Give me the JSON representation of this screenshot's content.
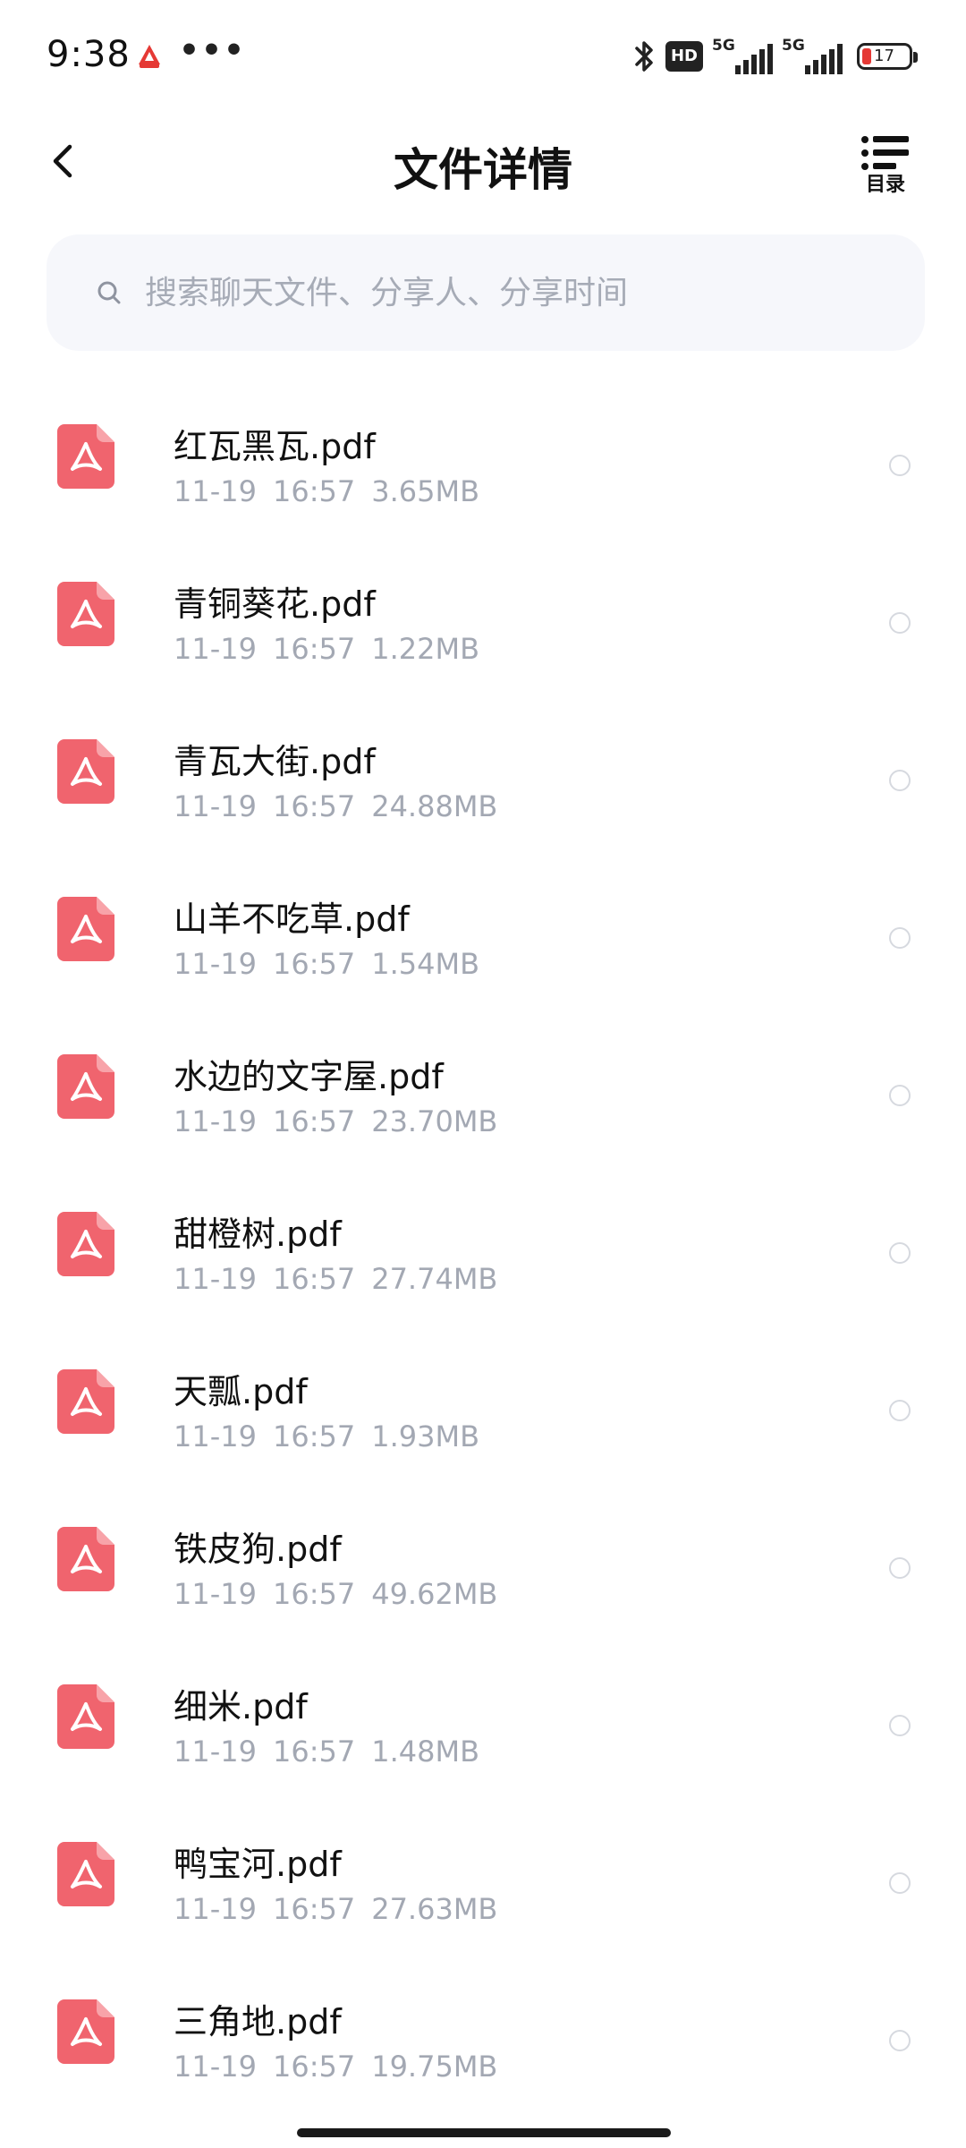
{
  "status_bar": {
    "time": "9:38",
    "dots": "•••",
    "hd_badge": "HD",
    "signal1_label": "5G",
    "signal2_label": "5G",
    "battery_level": "17"
  },
  "header": {
    "title": "文件详情",
    "catalog_label": "目录"
  },
  "search": {
    "placeholder": "搜索聊天文件、分享人、分享时间"
  },
  "files": [
    {
      "name": "红瓦黑瓦.pdf",
      "date": "11-19",
      "time": "16:57",
      "size": "3.65MB"
    },
    {
      "name": "青铜葵花.pdf",
      "date": "11-19",
      "time": "16:57",
      "size": "1.22MB"
    },
    {
      "name": "青瓦大街.pdf",
      "date": "11-19",
      "time": "16:57",
      "size": "24.88MB"
    },
    {
      "name": "山羊不吃草.pdf",
      "date": "11-19",
      "time": "16:57",
      "size": "1.54MB"
    },
    {
      "name": "水边的文字屋.pdf",
      "date": "11-19",
      "time": "16:57",
      "size": "23.70MB"
    },
    {
      "name": "甜橙树.pdf",
      "date": "11-19",
      "time": "16:57",
      "size": "27.74MB"
    },
    {
      "name": "天瓢.pdf",
      "date": "11-19",
      "time": "16:57",
      "size": "1.93MB"
    },
    {
      "name": "铁皮狗.pdf",
      "date": "11-19",
      "time": "16:57",
      "size": "49.62MB"
    },
    {
      "name": "细米.pdf",
      "date": "11-19",
      "time": "16:57",
      "size": "1.48MB"
    },
    {
      "name": "鸭宝河.pdf",
      "date": "11-19",
      "time": "16:57",
      "size": "27.63MB"
    },
    {
      "name": "三角地.pdf",
      "date": "11-19",
      "time": "16:57",
      "size": "19.75MB"
    }
  ],
  "colors": {
    "pdf_icon": "#f0646e",
    "meta_text": "#a3a8b3",
    "search_bg": "#f6f7fb"
  }
}
